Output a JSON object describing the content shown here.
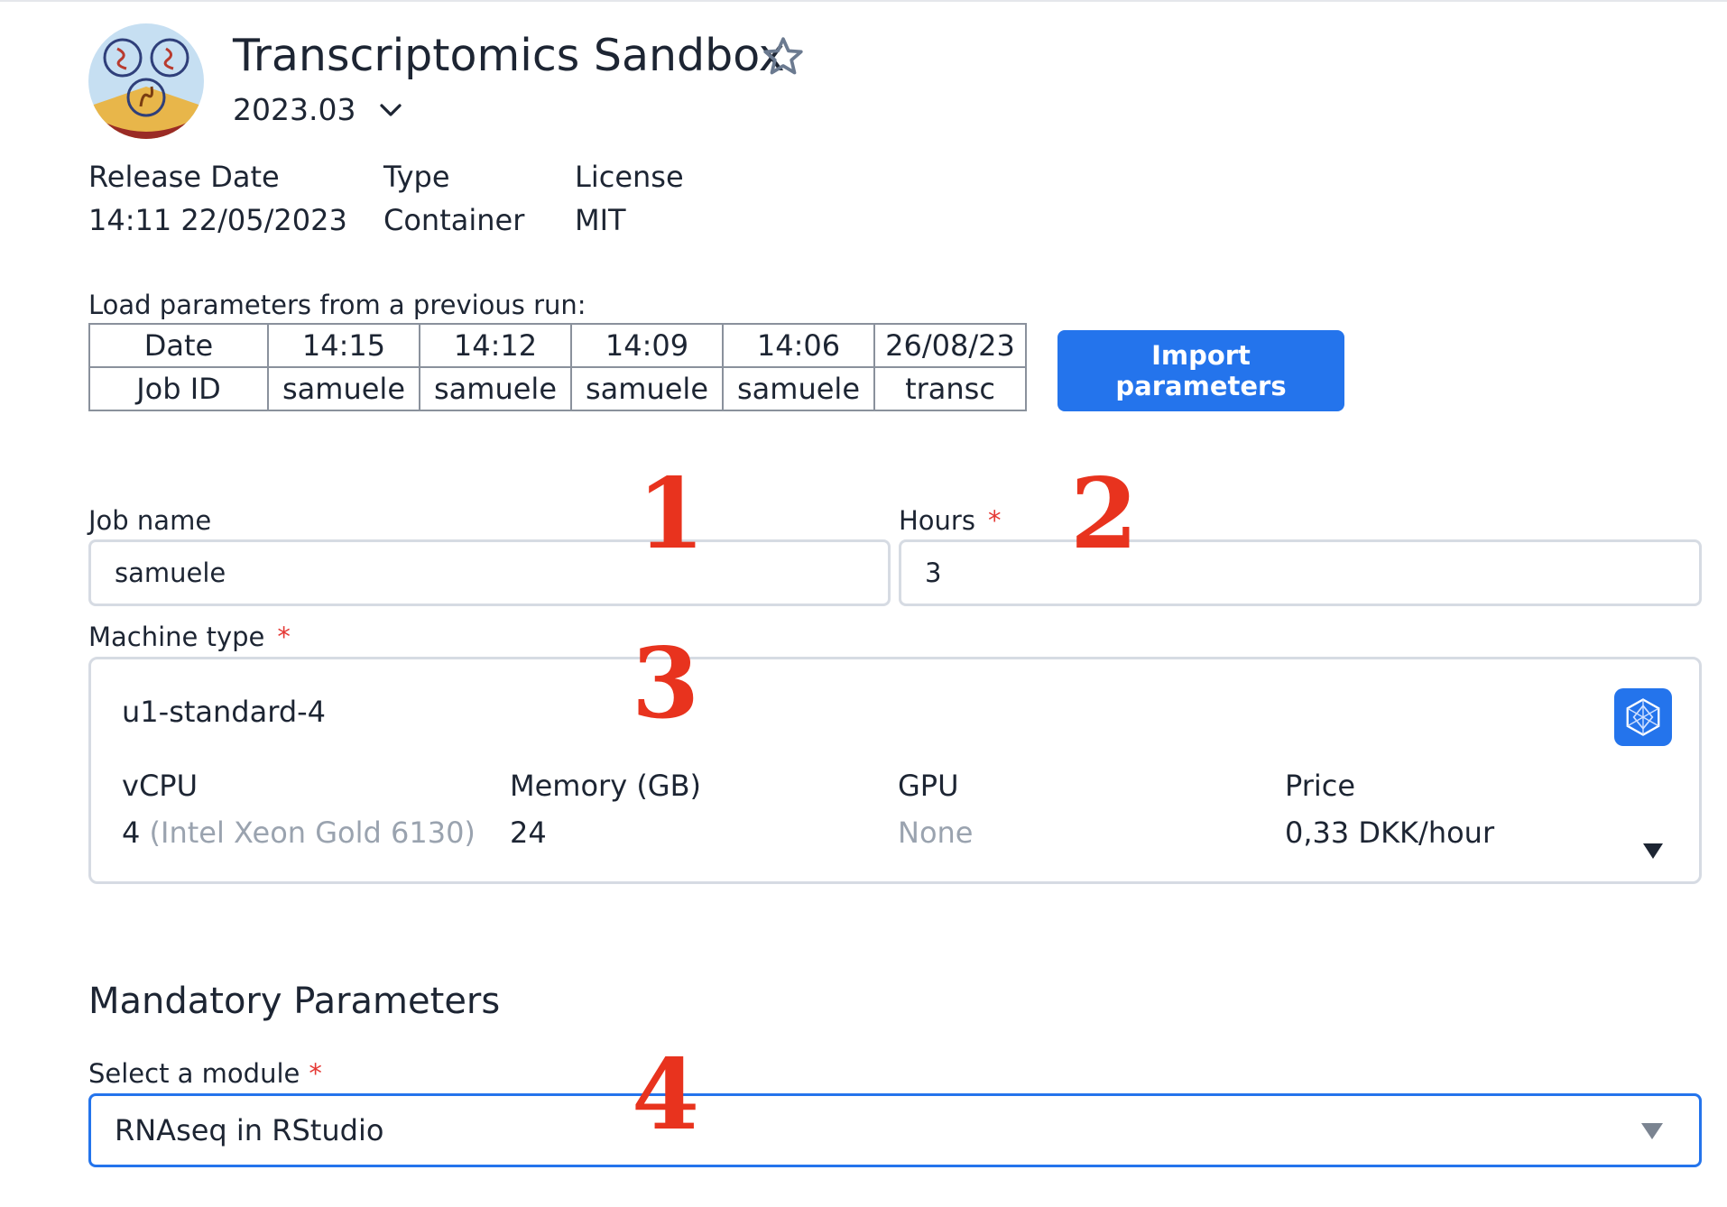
{
  "app": {
    "title": "Transcriptomics Sandbox",
    "version": "2023.03"
  },
  "meta": {
    "release_label": "Release Date",
    "release_value": "14:11 22/05/2023",
    "type_label": "Type",
    "type_value": "Container",
    "license_label": "License",
    "license_value": "MIT"
  },
  "previous_runs": {
    "label": "Load parameters from a previous run:",
    "date_header": "Date",
    "jobid_header": "Job ID",
    "runs": [
      {
        "date": "14:15",
        "job": "samuele"
      },
      {
        "date": "14:12",
        "job": "samuele"
      },
      {
        "date": "14:09",
        "job": "samuele"
      },
      {
        "date": "14:06",
        "job": "samuele"
      },
      {
        "date": "26/08/23",
        "job": "transc"
      }
    ],
    "import_button": "Import parameters"
  },
  "form": {
    "job_name_label": "Job name",
    "job_name_value": "samuele",
    "hours_label": "Hours",
    "hours_value": "3",
    "required_mark": "*",
    "machine_type_label": "Machine type"
  },
  "machine": {
    "name": "u1-standard-4",
    "vcpu_label": "vCPU",
    "vcpu_value": "4",
    "vcpu_detail": "(Intel Xeon Gold 6130)",
    "memory_label": "Memory (GB)",
    "memory_value": "24",
    "gpu_label": "GPU",
    "gpu_value": "None",
    "price_label": "Price",
    "price_value": "0,33 DKK/hour"
  },
  "mandatory": {
    "section_title": "Mandatory Parameters",
    "module_label": "Select a module",
    "module_value": "RNAseq in RStudio"
  },
  "annotations": [
    "1",
    "2",
    "3",
    "4"
  ],
  "colors": {
    "accent": "#2474ec",
    "required": "#e53935",
    "annotation": "#e8331e"
  },
  "icons": {
    "favorite": "star-icon",
    "version_toggle": "chevron-down-icon",
    "machine": "hexagon-network-icon"
  }
}
